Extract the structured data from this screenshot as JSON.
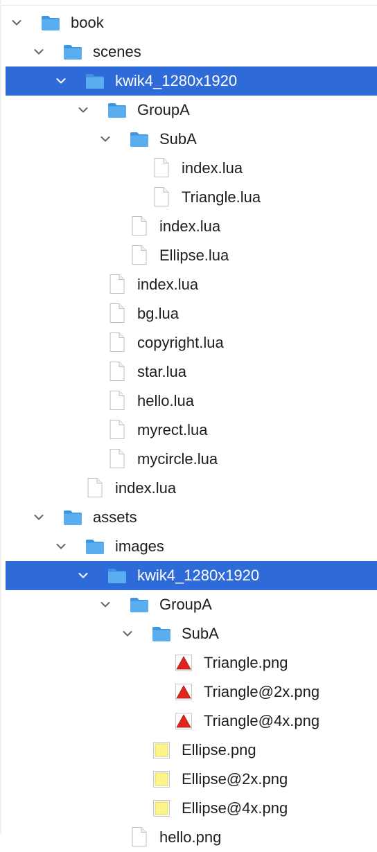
{
  "colors": {
    "selection": "#2f6ad9",
    "text": "#1d1d1f",
    "folder": "#5aaef0",
    "chevron": "#666666"
  },
  "tree": [
    {
      "label": "book",
      "type": "folder",
      "level": 0,
      "expanded": true,
      "selected": false
    },
    {
      "label": "scenes",
      "type": "folder",
      "level": 1,
      "expanded": true,
      "selected": false
    },
    {
      "label": "kwik4_1280x1920",
      "type": "folder",
      "level": 2,
      "expanded": true,
      "selected": true
    },
    {
      "label": "GroupA",
      "type": "folder",
      "level": 3,
      "expanded": true,
      "selected": false
    },
    {
      "label": "SubA",
      "type": "folder",
      "level": 4,
      "expanded": true,
      "selected": false
    },
    {
      "label": "index.lua",
      "type": "file",
      "level": 5,
      "selected": false
    },
    {
      "label": "Triangle.lua",
      "type": "file",
      "level": 5,
      "selected": false
    },
    {
      "label": "index.lua",
      "type": "file",
      "level": 4,
      "selected": false
    },
    {
      "label": "Ellipse.lua",
      "type": "file",
      "level": 4,
      "selected": false
    },
    {
      "label": "index.lua",
      "type": "file",
      "level": 3,
      "selected": false
    },
    {
      "label": "bg.lua",
      "type": "file",
      "level": 3,
      "selected": false
    },
    {
      "label": "copyright.lua",
      "type": "file",
      "level": 3,
      "selected": false
    },
    {
      "label": "star.lua",
      "type": "file",
      "level": 3,
      "selected": false
    },
    {
      "label": "hello.lua",
      "type": "file",
      "level": 3,
      "selected": false
    },
    {
      "label": "myrect.lua",
      "type": "file",
      "level": 3,
      "selected": false
    },
    {
      "label": "mycircle.lua",
      "type": "file",
      "level": 3,
      "selected": false
    },
    {
      "label": "index.lua",
      "type": "file",
      "level": 2,
      "selected": false
    },
    {
      "label": "assets",
      "type": "folder",
      "level": 1,
      "expanded": true,
      "selected": false
    },
    {
      "label": "images",
      "type": "folder",
      "level": 2,
      "expanded": true,
      "selected": false
    },
    {
      "label": "kwik4_1280x1920",
      "type": "folder",
      "level": 3,
      "expanded": true,
      "selected": true
    },
    {
      "label": "GroupA",
      "type": "folder",
      "level": 4,
      "expanded": true,
      "selected": false
    },
    {
      "label": "SubA",
      "type": "folder",
      "level": 5,
      "expanded": true,
      "selected": false
    },
    {
      "label": "Triangle.png",
      "type": "triangle-image",
      "level": 6,
      "selected": false
    },
    {
      "label": "Triangle@2x.png",
      "type": "triangle-image",
      "level": 6,
      "selected": false
    },
    {
      "label": "Triangle@4x.png",
      "type": "triangle-image",
      "level": 6,
      "selected": false
    },
    {
      "label": "Ellipse.png",
      "type": "ellipse-image",
      "level": 5,
      "selected": false
    },
    {
      "label": "Ellipse@2x.png",
      "type": "ellipse-image",
      "level": 5,
      "selected": false
    },
    {
      "label": "Ellipse@4x.png",
      "type": "ellipse-image",
      "level": 5,
      "selected": false
    },
    {
      "label": "hello.png",
      "type": "file",
      "level": 4,
      "selected": false
    }
  ]
}
